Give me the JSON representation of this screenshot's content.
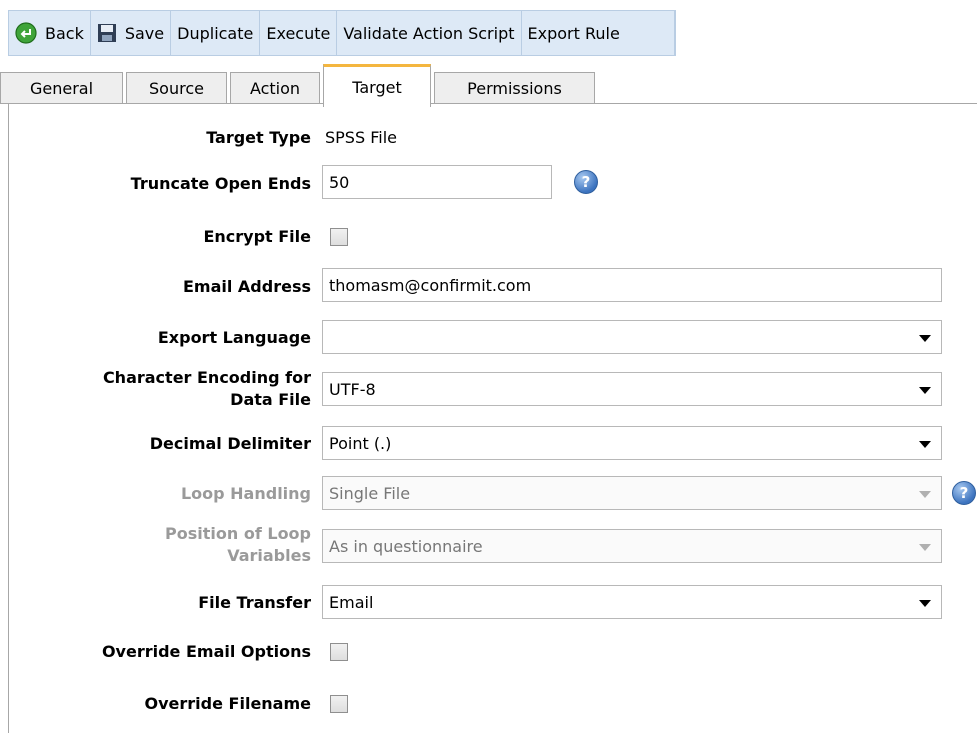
{
  "toolbar": {
    "back": "Back",
    "save": "Save",
    "duplicate": "Duplicate",
    "execute": "Execute",
    "validate": "Validate Action Script",
    "export_rule": "Export Rule"
  },
  "tabs": [
    "General",
    "Source",
    "Action",
    "Target",
    "Permissions"
  ],
  "active_tab": "Target",
  "form": {
    "target_type_label": "Target Type",
    "target_type_value": "SPSS File",
    "truncate_label": "Truncate Open Ends",
    "truncate_value": "50",
    "encrypt_label": "Encrypt File",
    "email_label": "Email Address",
    "email_value": "thomasm@confirmit.com",
    "export_language_label": "Export Language",
    "export_language_value": "",
    "char_encoding_label_1": "Character Encoding for",
    "char_encoding_label_2": "Data File",
    "char_encoding_value": "UTF-8",
    "decimal_label": "Decimal Delimiter",
    "decimal_value": "Point (.)",
    "loop_label": "Loop Handling",
    "loop_value": "Single File",
    "position_label_1": "Position of Loop",
    "position_label_2": "Variables",
    "position_value": "As in questionnaire",
    "file_transfer_label": "File Transfer",
    "file_transfer_value": "Email",
    "override_email_label": "Override Email Options",
    "override_filename_label": "Override Filename"
  },
  "help_glyph": "?",
  "colors": {
    "toolbar_bg": "#dde9f6",
    "active_tab_accent": "#f4b63f",
    "disabled_text": "#9a9a9a"
  }
}
